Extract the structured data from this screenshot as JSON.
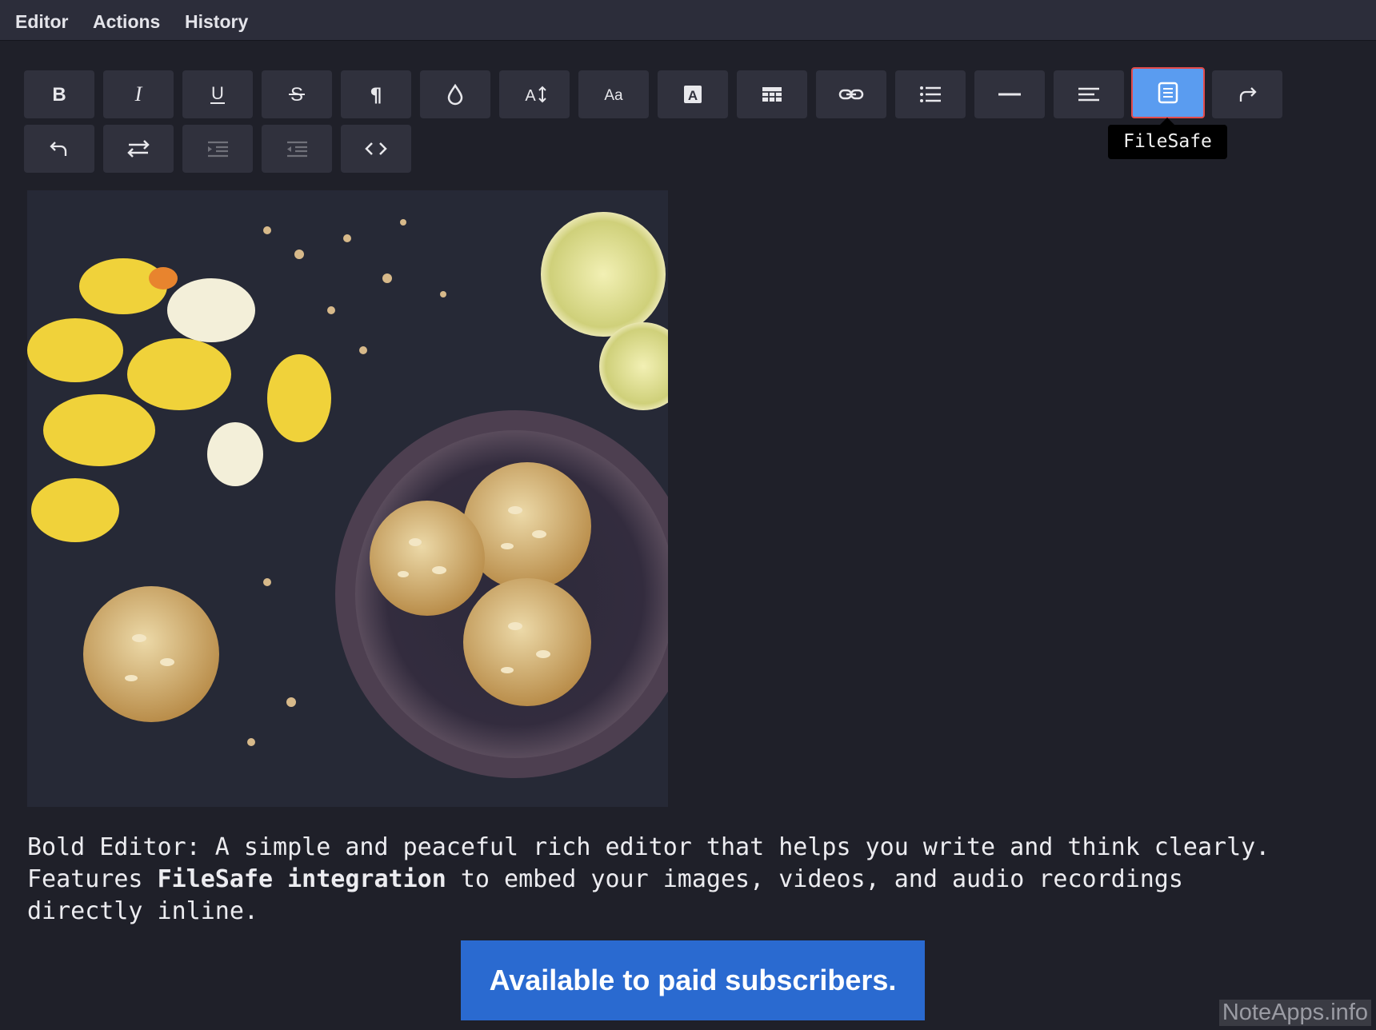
{
  "menu": {
    "editor": "Editor",
    "actions": "Actions",
    "history": "History"
  },
  "toolbar": {
    "row1": [
      "bold-icon",
      "italic-icon",
      "underline-icon",
      "strikethrough-icon",
      "paragraph-icon",
      "color-drop-icon",
      "font-size-icon",
      "font-family-icon",
      "highlight-icon",
      "table-icon",
      "link-icon",
      "list-icon",
      "horizontal-rule-icon",
      "align-left-icon",
      "filesafe-icon",
      "redo-icon"
    ],
    "row2": [
      "undo-icon",
      "swap-direction-icon",
      "indent-icon",
      "outdent-icon",
      "code-icon"
    ],
    "active": "filesafe-icon",
    "tooltip": "FileSafe",
    "accent": "#5a9cf0"
  },
  "content": {
    "line1": "Bold Editor: A simple and peaceful rich editor that helps you write and think clearly.",
    "line2_before": "Features ",
    "line2_bold": "FileSafe integration",
    "line2_after": " to embed your images, videos, and audio recordings",
    "line3": "directly inline."
  },
  "cta": {
    "label": "Available to paid subscribers.",
    "color": "#2a6ad0"
  },
  "watermark": "NoteApps.info"
}
